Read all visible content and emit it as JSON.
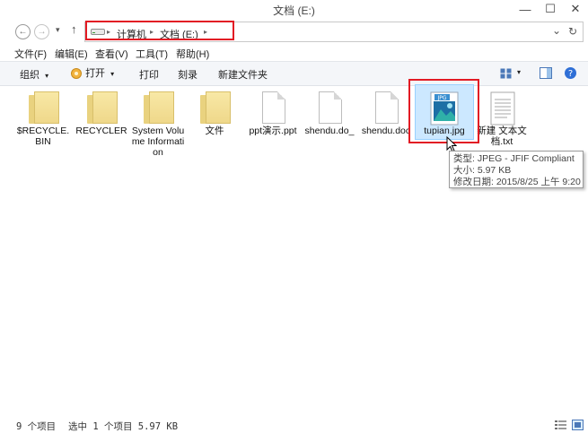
{
  "window": {
    "title": "文档 (E:)",
    "minimize_glyph": "—",
    "maximize_glyph": "☐",
    "close_glyph": "✕"
  },
  "navigation": {
    "back_glyph": "←",
    "forward_glyph": "→",
    "recent_glyph": "▾",
    "up_glyph": "↑",
    "dropdown_glyph": "⌄",
    "refresh_glyph": "↻"
  },
  "address": {
    "separator": "▸",
    "crumbs": [
      "计算机",
      "文档 (E:)"
    ]
  },
  "menu": [
    "文件(F)",
    "编辑(E)",
    "查看(V)",
    "工具(T)",
    "帮助(H)"
  ],
  "toolbar": {
    "organize": "组织",
    "open": "打开",
    "print": "打印",
    "burn": "刻录",
    "new_folder": "新建文件夹",
    "dropdown_glyph": "▾"
  },
  "files": [
    {
      "name": "$RECYCLE.BIN",
      "type": "folder"
    },
    {
      "name": "RECYCLER",
      "type": "folder"
    },
    {
      "name": "System Volume Information",
      "type": "folder"
    },
    {
      "name": "文件",
      "type": "folder"
    },
    {
      "name": "ppt演示.ppt",
      "type": "document"
    },
    {
      "name": "shendu.do_",
      "type": "document"
    },
    {
      "name": "shendu.doc",
      "type": "document"
    },
    {
      "name": "tupian.jpg",
      "type": "image",
      "badge": "JPG"
    },
    {
      "name": "新建 文本文档.txt",
      "type": "text"
    }
  ],
  "tooltip": {
    "type_line": "类型: JPEG - JFIF Compliant",
    "size_line": "大小: 5.97 KB",
    "modified_line": "修改日期: 2015/8/25 上午 9:20"
  },
  "status": {
    "item_count": "9 个项目",
    "selection": "选中 1 个项目  5.97 KB"
  },
  "colors": {
    "highlight": "#e21b24",
    "selection": "#cce8ff"
  }
}
